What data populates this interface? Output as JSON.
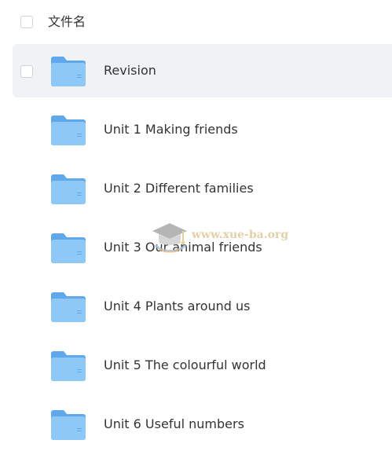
{
  "header": {
    "column_label": "文件名"
  },
  "rows": [
    {
      "name": "Revision",
      "icon": "folder-icon",
      "selected": true
    },
    {
      "name": "Unit 1 Making friends",
      "icon": "folder-icon",
      "selected": false
    },
    {
      "name": "Unit 2 Different families",
      "icon": "folder-icon",
      "selected": false
    },
    {
      "name": "Unit 3 Our animal friends",
      "icon": "folder-icon",
      "selected": false
    },
    {
      "name": "Unit 4 Plants around us",
      "icon": "folder-icon",
      "selected": false
    },
    {
      "name": "Unit 5 The colourful world",
      "icon": "folder-icon",
      "selected": false
    },
    {
      "name": "Unit 6 Useful numbers",
      "icon": "folder-icon",
      "selected": false
    }
  ],
  "watermark": {
    "text": "www.xue-ba.org",
    "icon": "graduation-cap-icon"
  },
  "colors": {
    "folder_back": "#5fa8ec",
    "folder_front": "#8ec8f6",
    "selected_row": "#f1f2f5",
    "watermark": "#dfc79a"
  }
}
